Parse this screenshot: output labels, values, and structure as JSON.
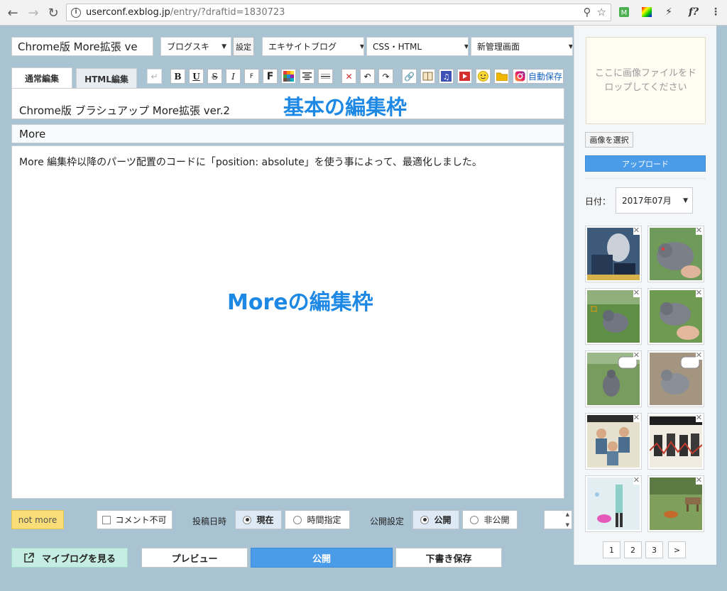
{
  "browser": {
    "url_host": "userconf.exblog.jp",
    "url_path": "/entry/?draftid=1830723",
    "ext_f_label": "f?"
  },
  "editor": {
    "title_value": "Chrome版 More拡張 ve",
    "skin_select": "ブログスキ",
    "settings_button": "設定",
    "blog_select": "エキサイトブログ",
    "css_select": "CSS・HTML",
    "admin_select": "新管理画面",
    "tabs": [
      "通常編集",
      "HTML編集"
    ],
    "autosave_label": "自動保存",
    "body_text": "Chrome版 ブラシュアップ More拡張 ver.2",
    "basic_overlay": "基本の編集枠",
    "more_label": "More",
    "more_text": "More 編集枠以降のパーツ配置のコードに「position: absolute」を使う事によって、最適化しました。",
    "more_overlay": "Moreの編集枠",
    "toolbar": {
      "bold": "B",
      "underline": "U",
      "strike": "S",
      "italic": "I",
      "font_small": "F",
      "font_large": "F"
    }
  },
  "bottom": {
    "not_more": "not more",
    "comment_disabled": "コメント不可",
    "post_date_label": "投稿日時",
    "now": "現在",
    "time_specify": "時間指定",
    "publish_setting_label": "公開設定",
    "public": "公開",
    "private": "非公開",
    "view_blog": "マイブログを見る",
    "preview": "プレビュー",
    "publish": "公開",
    "save_draft": "下書き保存"
  },
  "sidebar": {
    "dropzone_text": "ここに画像ファイルをドロップしてください",
    "select_image": "画像を選択",
    "upload": "アップロード",
    "date_label": "日付：",
    "date_value": "2017年07月",
    "pages": [
      "1",
      "2",
      "3",
      ">"
    ]
  },
  "colors": {
    "accent": "#4a9be8",
    "overlay_text": "#1e88e5",
    "page_bg": "#a9c3d3",
    "not_more_bg": "#f9de78",
    "view_blog_bg": "#c6ede2"
  }
}
